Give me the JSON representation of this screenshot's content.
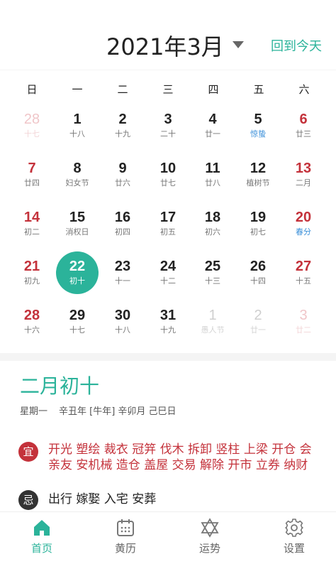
{
  "header": {
    "month_title": "2021年3月",
    "today_label": "回到今天"
  },
  "weekdays": [
    "日",
    "一",
    "二",
    "三",
    "四",
    "五",
    "六"
  ],
  "calendar": {
    "days": [
      {
        "num": "28",
        "sub": "十七",
        "other": true
      },
      {
        "num": "1",
        "sub": "十八"
      },
      {
        "num": "2",
        "sub": "十九"
      },
      {
        "num": "3",
        "sub": "二十"
      },
      {
        "num": "4",
        "sub": "廿一"
      },
      {
        "num": "5",
        "sub": "惊蛰",
        "solar": true
      },
      {
        "num": "6",
        "sub": "廿三"
      },
      {
        "num": "7",
        "sub": "廿四"
      },
      {
        "num": "8",
        "sub": "妇女节"
      },
      {
        "num": "9",
        "sub": "廿六"
      },
      {
        "num": "10",
        "sub": "廿七"
      },
      {
        "num": "11",
        "sub": "廿八"
      },
      {
        "num": "12",
        "sub": "植树节"
      },
      {
        "num": "13",
        "sub": "二月"
      },
      {
        "num": "14",
        "sub": "初二"
      },
      {
        "num": "15",
        "sub": "消权日"
      },
      {
        "num": "16",
        "sub": "初四"
      },
      {
        "num": "17",
        "sub": "初五"
      },
      {
        "num": "18",
        "sub": "初六"
      },
      {
        "num": "19",
        "sub": "初七"
      },
      {
        "num": "20",
        "sub": "春分",
        "solar": true
      },
      {
        "num": "21",
        "sub": "初九"
      },
      {
        "num": "22",
        "sub": "初十",
        "selected": true
      },
      {
        "num": "23",
        "sub": "十一"
      },
      {
        "num": "24",
        "sub": "十二"
      },
      {
        "num": "25",
        "sub": "十三"
      },
      {
        "num": "26",
        "sub": "十四"
      },
      {
        "num": "27",
        "sub": "十五"
      },
      {
        "num": "28",
        "sub": "十六"
      },
      {
        "num": "29",
        "sub": "十七"
      },
      {
        "num": "30",
        "sub": "十八"
      },
      {
        "num": "31",
        "sub": "十九"
      },
      {
        "num": "1",
        "sub": "愚人节",
        "other": true
      },
      {
        "num": "2",
        "sub": "廿一",
        "other": true
      },
      {
        "num": "3",
        "sub": "廿二",
        "other": true
      }
    ]
  },
  "detail": {
    "lunar_date": "二月初十",
    "weekday": "星期一",
    "ganzhi": "辛丑年 [牛年] 辛卯月 己巳日",
    "yi_label": "宜",
    "yi_text": "开光 塑绘 裁衣 冠笄 伐木 拆卸 竖柱 上梁 开仓 会亲友 安机械 造仓 盖屋 交易 解除 开市 立券 纳财",
    "ji_label": "忌",
    "ji_text": "出行 嫁娶 入宅 安葬"
  },
  "tabs": [
    {
      "label": "首页",
      "icon": "home-icon",
      "active": true
    },
    {
      "label": "黄历",
      "icon": "calendar-icon"
    },
    {
      "label": "运势",
      "icon": "star-of-david-icon"
    },
    {
      "label": "设置",
      "icon": "gear-icon"
    }
  ],
  "colors": {
    "accent": "#2bb39a",
    "weekend_red": "#c4323b",
    "solar_term_blue": "#3a8fd9"
  }
}
